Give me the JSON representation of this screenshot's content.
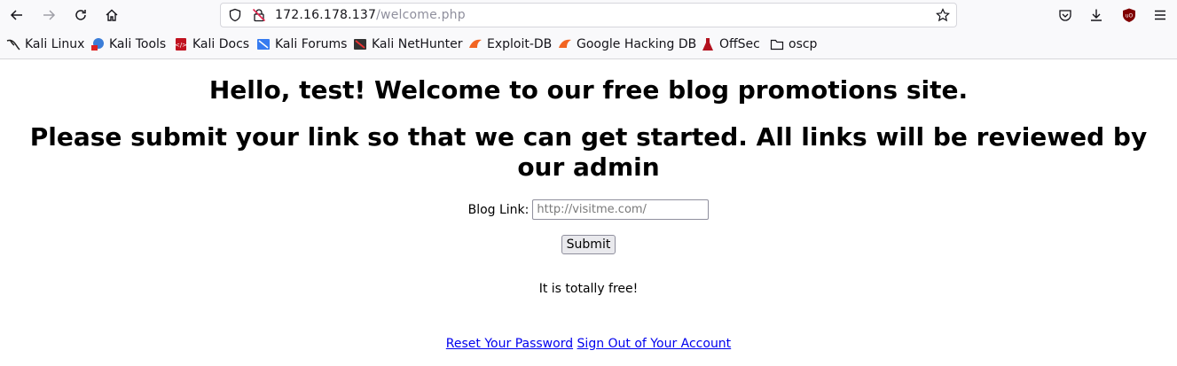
{
  "browser": {
    "url_host": "172.16.178.137",
    "url_path": "/welcome.php",
    "icons": [
      "back-icon",
      "forward-icon",
      "reload-icon",
      "home-icon",
      "shield-icon",
      "insecure-lock-icon",
      "star-icon",
      "pocket-icon",
      "download-icon",
      "ublock-icon",
      "menu-icon"
    ]
  },
  "bookmarks": [
    {
      "label": "Kali Linux"
    },
    {
      "label": "Kali Tools"
    },
    {
      "label": "Kali Docs"
    },
    {
      "label": "Kali Forums"
    },
    {
      "label": "Kali NetHunter"
    },
    {
      "label": "Exploit-DB"
    },
    {
      "label": "Google Hacking DB"
    },
    {
      "label": "OffSec"
    },
    {
      "label": "oscp"
    }
  ],
  "page": {
    "heading_welcome": "Hello, test! Welcome to our free blog promotions site.",
    "heading_submit": "Please submit your link so that we can get started. All links will be reviewed by our admin",
    "form": {
      "label": "Blog Link:",
      "placeholder": "http://visitme.com/",
      "submit_label": "Submit"
    },
    "free_text": "It is totally free!",
    "links": {
      "reset_password": "Reset Your Password",
      "sign_out": "Sign Out of Your Account"
    }
  }
}
